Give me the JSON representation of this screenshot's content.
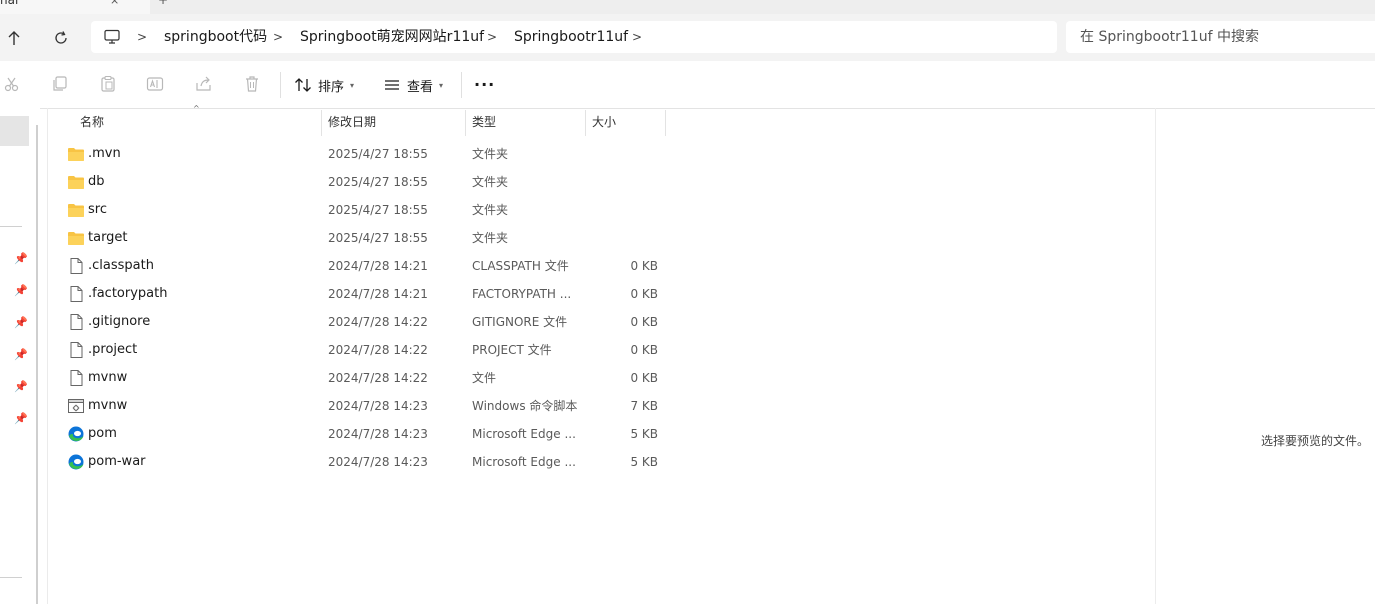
{
  "window": {
    "tab_label": "nal",
    "tab_close": "×",
    "tab_plus": "+"
  },
  "nav": {
    "up_icon": "arrow-up-icon",
    "refresh_icon": "refresh-icon"
  },
  "address": {
    "computer_icon": "computer-icon",
    "breadcrumbs": [
      "springboot代码",
      "Springboot萌宠网网站r11uf",
      "Springbootr11uf"
    ],
    "chevron": ">"
  },
  "search": {
    "placeholder": "在 Springbootr11uf 中搜索"
  },
  "toolbar": {
    "sort_label": "排序",
    "view_label": "查看",
    "more_label": "···",
    "icons": [
      "cut-icon",
      "copy-icon",
      "paste-icon",
      "rename-icon",
      "share-icon",
      "delete-icon"
    ]
  },
  "columns": {
    "name": "名称",
    "modified": "修改日期",
    "type": "类型",
    "size": "大小"
  },
  "files": [
    {
      "name": ".mvn",
      "modified": "2025/4/27 18:55",
      "type": "文件夹",
      "size": "",
      "icon": "folder-icon"
    },
    {
      "name": "db",
      "modified": "2025/4/27 18:55",
      "type": "文件夹",
      "size": "",
      "icon": "folder-icon"
    },
    {
      "name": "src",
      "modified": "2025/4/27 18:55",
      "type": "文件夹",
      "size": "",
      "icon": "folder-icon"
    },
    {
      "name": "target",
      "modified": "2025/4/27 18:55",
      "type": "文件夹",
      "size": "",
      "icon": "folder-icon"
    },
    {
      "name": ".classpath",
      "modified": "2024/7/28 14:21",
      "type": "CLASSPATH 文件",
      "size": "0 KB",
      "icon": "file-icon"
    },
    {
      "name": ".factorypath",
      "modified": "2024/7/28 14:21",
      "type": "FACTORYPATH ...",
      "size": "0 KB",
      "icon": "file-icon"
    },
    {
      "name": ".gitignore",
      "modified": "2024/7/28 14:22",
      "type": "GITIGNORE 文件",
      "size": "0 KB",
      "icon": "file-icon"
    },
    {
      "name": ".project",
      "modified": "2024/7/28 14:22",
      "type": "PROJECT 文件",
      "size": "0 KB",
      "icon": "file-icon"
    },
    {
      "name": "mvnw",
      "modified": "2024/7/28 14:22",
      "type": "文件",
      "size": "0 KB",
      "icon": "file-icon"
    },
    {
      "name": "mvnw",
      "modified": "2024/7/28 14:23",
      "type": "Windows 命令脚本",
      "size": "7 KB",
      "icon": "script-icon"
    },
    {
      "name": "pom",
      "modified": "2024/7/28 14:23",
      "type": "Microsoft Edge ...",
      "size": "5 KB",
      "icon": "edge-icon"
    },
    {
      "name": "pom-war",
      "modified": "2024/7/28 14:23",
      "type": "Microsoft Edge ...",
      "size": "5 KB",
      "icon": "edge-icon"
    }
  ],
  "preview": {
    "empty_text": "选择要预览的文件。"
  },
  "colors": {
    "folder": "#f8c444",
    "edge_blue": "#0c74d8",
    "edge_green": "#35c04f"
  }
}
